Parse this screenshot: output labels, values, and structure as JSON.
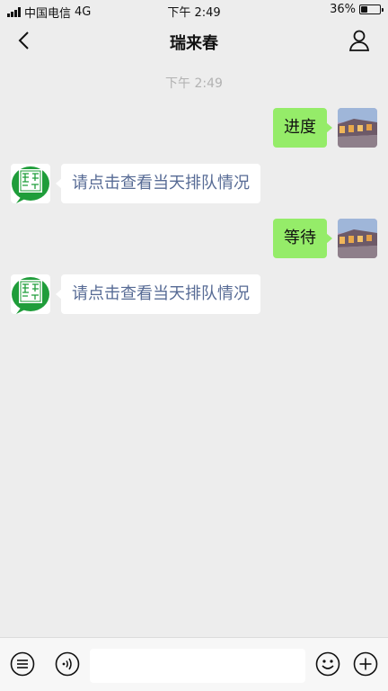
{
  "status_bar": {
    "carrier": "中国电信",
    "network": "4G",
    "time": "下午 2:49",
    "battery_percent": "36%",
    "battery_level": 0.36
  },
  "nav": {
    "title": "瑞来春",
    "back_icon": "chevron-left-icon",
    "profile_icon": "person-icon"
  },
  "chat": {
    "timestamp": "下午 2:49",
    "messages": [
      {
        "direction": "out",
        "text": "进度"
      },
      {
        "direction": "in",
        "text": "请点击查看当天排队情况"
      },
      {
        "direction": "out",
        "text": "等待"
      },
      {
        "direction": "in",
        "text": "请点击查看当天排队情况"
      }
    ]
  },
  "input_bar": {
    "menu_icon": "list-menu-icon",
    "voice_icon": "voice-icon",
    "emoji_icon": "emoji-icon",
    "plus_icon": "plus-icon",
    "input_value": ""
  },
  "colors": {
    "background": "#ededed",
    "outgoing_bubble": "#95ec69",
    "incoming_text": "#576b95",
    "seal_green": "#1f9d3a"
  }
}
